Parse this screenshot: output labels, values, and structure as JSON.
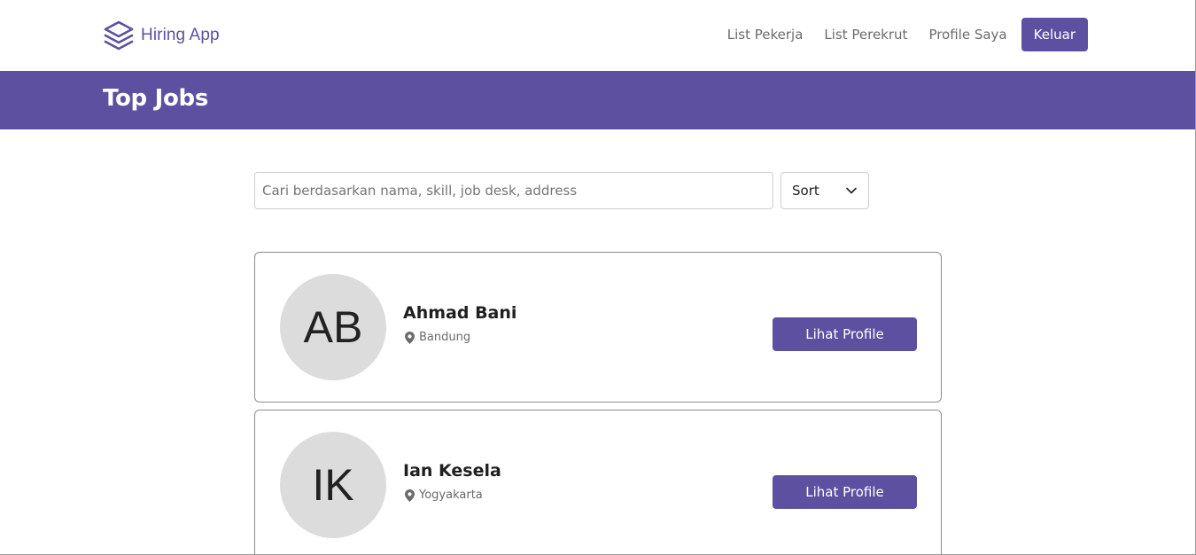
{
  "navbar": {
    "brand": {
      "text": "Hiring App",
      "icon": "layers-icon"
    },
    "links": [
      "List Pekerja",
      "List Perekrut",
      "Profile Saya"
    ],
    "logout_label": "Keluar"
  },
  "banner": {
    "title": "Top Jobs"
  },
  "search": {
    "placeholder": "Cari berdasarkan nama, skill, job desk, address",
    "value": ""
  },
  "sort": {
    "label": "Sort",
    "icon": "chevron-down-icon"
  },
  "candidates": [
    {
      "initials": "AB",
      "name": "Ahmad Bani",
      "location": "Bandung",
      "button_label": "Lihat Profile"
    },
    {
      "initials": "IK",
      "name": "Ian Kesela",
      "location": "Yogyakarta",
      "button_label": "Lihat Profile"
    }
  ],
  "colors": {
    "brand": "#5e50a1",
    "avatar_bg": "#dcdcdc",
    "muted_text": "#6b6b6b"
  }
}
